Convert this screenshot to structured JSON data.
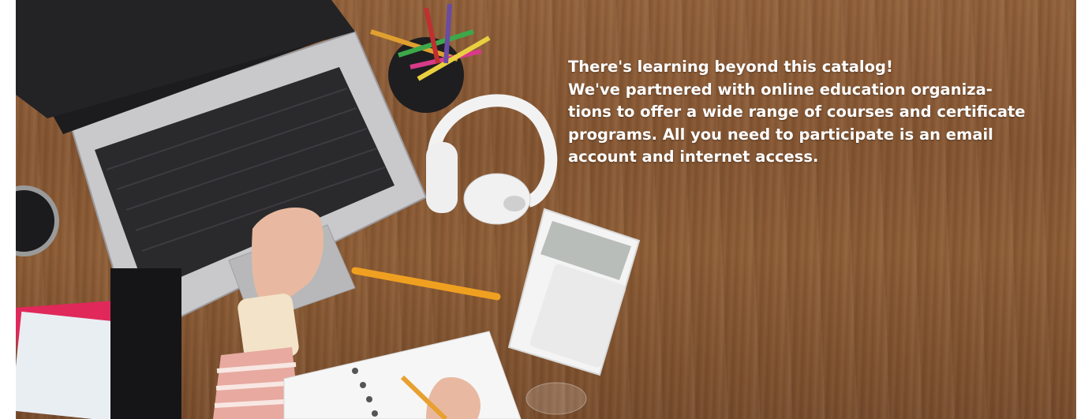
{
  "banner": {
    "heading": "There's learning beyond this catalog!",
    "line1": "We've partnered with online education organiza-",
    "line2": "tions to offer a wide range of courses and certificate",
    "line3": "programs. All you need to participate is an email",
    "line4": "account and internet access.",
    "image_alt": "Desk with laptop, headphones, calculator, notebook and pencils"
  }
}
